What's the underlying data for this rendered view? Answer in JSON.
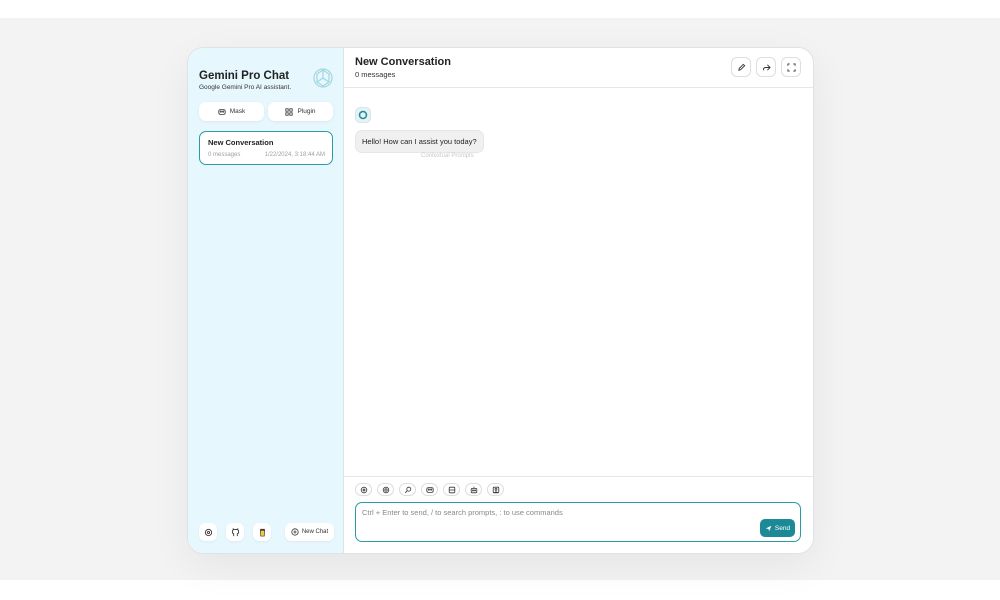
{
  "sidebar": {
    "title": "Gemini Pro Chat",
    "subtitle": "Google Gemini Pro AI assistant.",
    "mask_label": "Mask",
    "plugin_label": "Plugin",
    "chats": [
      {
        "title": "New Conversation",
        "count": "0 messages",
        "date": "1/22/2024, 3:18:44 AM"
      }
    ],
    "new_chat_label": "New Chat"
  },
  "header": {
    "title": "New Conversation",
    "subtitle": "0 messages"
  },
  "messages": [
    {
      "role": "bot",
      "text": "Hello! How can I assist you today?"
    }
  ],
  "context_prompt_label": "Contextual Prompts",
  "input": {
    "placeholder": "Ctrl + Enter to send, / to search prompts, : to use commands",
    "value": "",
    "send_label": "Send"
  },
  "colors": {
    "accent": "#1c8a96",
    "sidebar_bg": "#e6f7fd"
  },
  "icons": {
    "header": [
      "edit-icon",
      "share-icon",
      "fullscreen-icon"
    ],
    "toolbar": [
      "settings-icon",
      "theme-icon",
      "prompt-icon",
      "mask-icon",
      "clear-icon",
      "robot-icon",
      "image-icon"
    ],
    "footer": [
      "settings-icon",
      "github-icon",
      "coffee-icon"
    ]
  }
}
